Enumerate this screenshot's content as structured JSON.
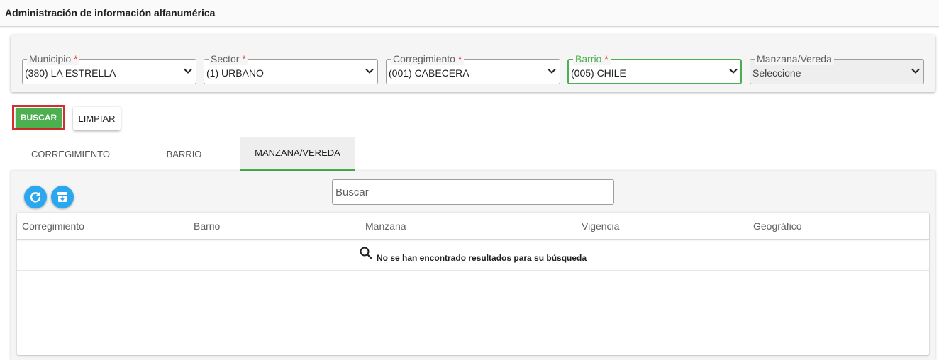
{
  "header": {
    "title": "Administración de información alfanumérica"
  },
  "filters": [
    {
      "label": "Municipio",
      "required": "*",
      "value": "(380) LA ESTRELLA"
    },
    {
      "label": "Sector",
      "required": "*",
      "value": "(1) URBANO"
    },
    {
      "label": "Corregimiento",
      "required": "*",
      "value": "(001) CABECERA"
    },
    {
      "label": "Barrio",
      "required": "*",
      "value": "(005) CHILE"
    },
    {
      "label": "Manzana/Vereda",
      "required": "",
      "value": "Seleccione"
    }
  ],
  "actions": {
    "search_label": "BUSCAR",
    "clear_label": "LIMPIAR"
  },
  "tabs": [
    {
      "label": "CORREGIMIENTO"
    },
    {
      "label": "BARRIO"
    },
    {
      "label": "MANZANA/VEREDA",
      "active": true
    }
  ],
  "grid": {
    "search_placeholder": "Buscar",
    "columns": [
      "Corregimiento",
      "Barrio",
      "Manzana",
      "Vigencia",
      "Geográfico"
    ],
    "empty_message": "No se han encontrado resultados para su búsqueda"
  },
  "colors": {
    "accent": "#4caf50",
    "required": "#e53935",
    "highlight": "#d32f2f",
    "fab": "#29a8f0"
  },
  "icons": {
    "refresh": "refresh-icon",
    "archive": "archive-icon",
    "search": "search-icon",
    "chevron": "chevron-down-icon"
  }
}
